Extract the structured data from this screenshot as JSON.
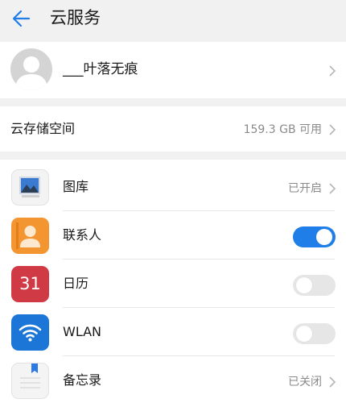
{
  "header": {
    "title": "云服务",
    "back_icon": "back-arrow-icon"
  },
  "account": {
    "name": "___叶落无痕"
  },
  "storage": {
    "label": "云存储空间",
    "value": "159.3 GB 可用"
  },
  "apps": [
    {
      "label": "图库",
      "status": "已开启",
      "control": "chevron",
      "icon": "gallery-icon"
    },
    {
      "label": "联系人",
      "control": "toggle",
      "enabled": true,
      "icon": "contacts-icon"
    },
    {
      "label": "日历",
      "control": "toggle",
      "enabled": false,
      "icon": "calendar-icon",
      "icon_text": "31"
    },
    {
      "label": "WLAN",
      "control": "toggle",
      "enabled": false,
      "icon": "wlan-icon"
    },
    {
      "label": "备忘录",
      "status": "已关闭",
      "control": "chevron",
      "icon": "notepad-icon"
    }
  ],
  "colors": {
    "accent": "#1f7ee8",
    "background": "#f1f1f1"
  }
}
